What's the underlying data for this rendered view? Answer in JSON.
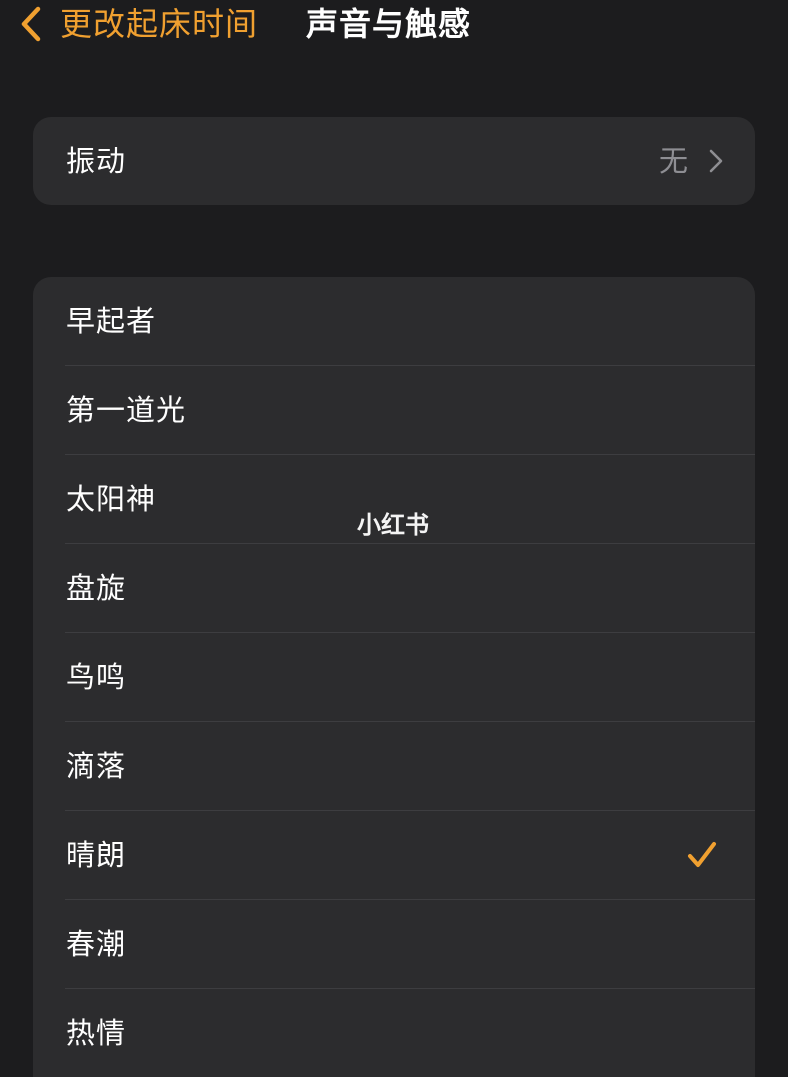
{
  "nav": {
    "back_label": "更改起床时间",
    "title": "声音与触感"
  },
  "vibration": {
    "label": "振动",
    "value": "无"
  },
  "sounds": [
    {
      "label": "早起者",
      "selected": false
    },
    {
      "label": "第一道光",
      "selected": false
    },
    {
      "label": "太阳神",
      "selected": false
    },
    {
      "label": "盘旋",
      "selected": false
    },
    {
      "label": "鸟鸣",
      "selected": false
    },
    {
      "label": "滴落",
      "selected": false
    },
    {
      "label": "晴朗",
      "selected": true
    },
    {
      "label": "春潮",
      "selected": false
    },
    {
      "label": "热情",
      "selected": false
    }
  ],
  "watermark": "小红书",
  "colors": {
    "background": "#1c1c1e",
    "group_background": "#2c2c2e",
    "accent": "#f0a030",
    "secondary_text": "#8e8e93"
  },
  "icons": {
    "back": "chevron-left-icon",
    "disclosure": "chevron-right-icon",
    "selected": "checkmark-icon"
  }
}
